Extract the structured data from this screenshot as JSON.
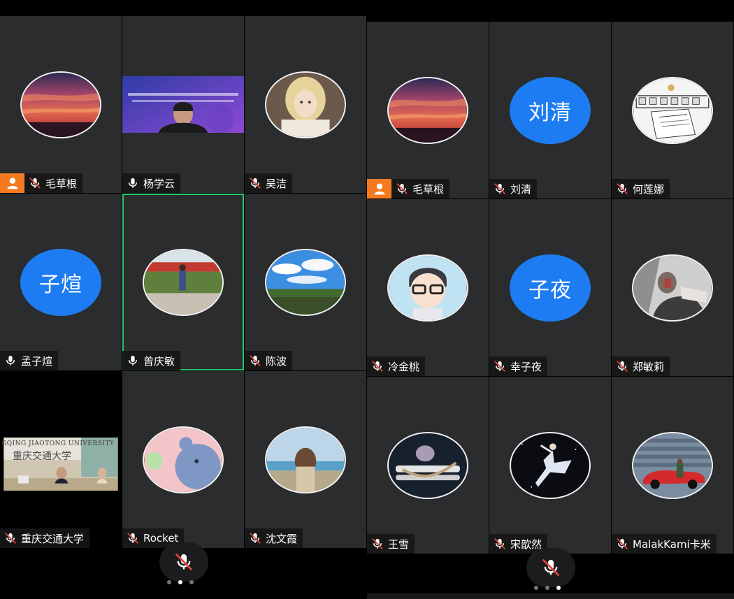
{
  "colors": {
    "host": "#f47a22",
    "active_border": "#2fc36a",
    "text_avatar": "#1d7cf2",
    "mic_muted": "#e0443e",
    "mic_on": "#ffffff"
  },
  "left_grid": [
    {
      "name": "毛草根",
      "mic": "muted",
      "host": true,
      "avatar": "sunset-photo"
    },
    {
      "name": "杨学云",
      "mic": "on",
      "video": "conference-banner"
    },
    {
      "name": "吴洁",
      "mic": "muted",
      "avatar": "doll-photo"
    },
    {
      "name": "孟子煊",
      "mic": "on",
      "avatar_text": "子煊"
    },
    {
      "name": "曾庆敏",
      "mic": "on",
      "active": true,
      "avatar": "garden-photo"
    },
    {
      "name": "陈波",
      "mic": "muted",
      "avatar": "sky-photo"
    },
    {
      "name": "重庆交通大学",
      "mic": "muted",
      "video": "university-room",
      "video_text": {
        "banner_en": "GQING JIAOTONG UNIVERSITY",
        "banner_cn": "重庆交通大学"
      }
    },
    {
      "name": "Rocket",
      "mic": "muted",
      "avatar": "bear-illustration"
    },
    {
      "name": "沈文霞",
      "mic": "muted",
      "avatar": "seaside-photo"
    }
  ],
  "right_grid": [
    {
      "name": "毛草根",
      "mic": "muted",
      "host": true,
      "avatar": "sunset-photo"
    },
    {
      "name": "刘清",
      "mic": "muted",
      "avatar_text": "刘清"
    },
    {
      "name": "何莲娜",
      "mic": "muted",
      "avatar": "newspaper-sketch"
    },
    {
      "name": "冷金桃",
      "mic": "muted",
      "avatar": "cartoon-boy"
    },
    {
      "name": "幸子夜",
      "mic": "muted",
      "avatar_text": "子夜"
    },
    {
      "name": "郑敏莉",
      "mic": "muted",
      "avatar": "bw-portrait"
    },
    {
      "name": "王雪",
      "mic": "muted",
      "avatar": "guitar-photo"
    },
    {
      "name": "宋歆然",
      "mic": "muted",
      "avatar": "dancer-photo"
    },
    {
      "name": "MalakKami卡米",
      "mic": "muted",
      "avatar": "red-car-photo"
    }
  ],
  "pager_left": {
    "count": 3,
    "active": 1
  },
  "pager_right": {
    "count": 3,
    "active": 2
  }
}
